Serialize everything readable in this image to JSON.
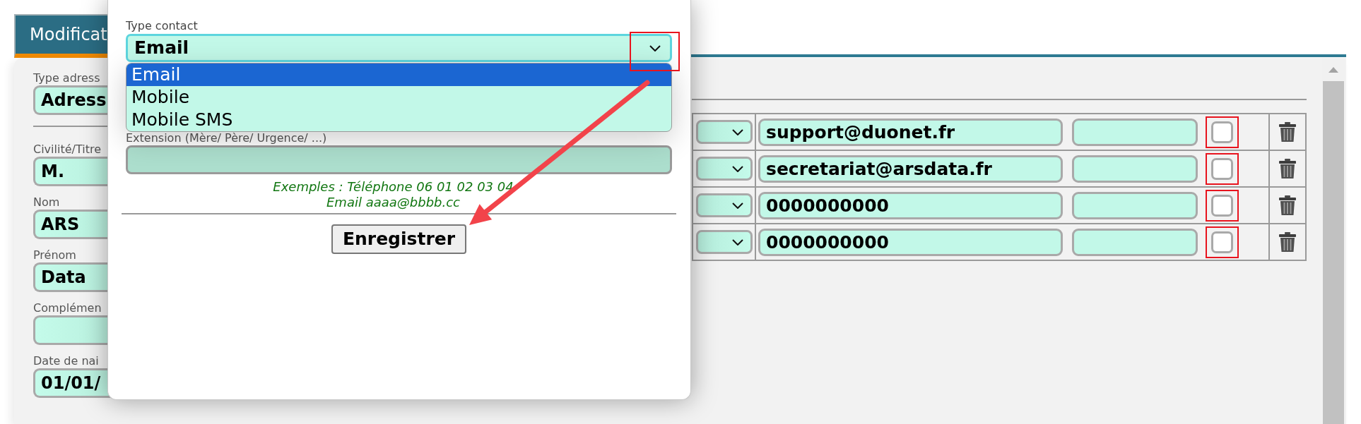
{
  "tab": {
    "label": "Modificat",
    "selected": true
  },
  "address_form": {
    "sections": [
      [
        {
          "label": "Type adress",
          "value": "Adress"
        }
      ],
      [
        {
          "label": "Civilité/Titre",
          "value": "M."
        },
        {
          "label": "Nom",
          "value": "ARS"
        },
        {
          "label": "Prénom",
          "value": "Data"
        },
        {
          "label": "Complémen"
        },
        {
          "label": "Date de nai",
          "value": "01/01/"
        }
      ]
    ]
  },
  "contacts": {
    "rows": [
      {
        "value": "support@duonet.fr",
        "checked": false,
        "highlighted": true
      },
      {
        "value": "secretariat@arsdata.fr",
        "checked": false,
        "highlighted": true
      },
      {
        "value": "0000000000",
        "checked": false,
        "highlighted": true
      },
      {
        "value": "0000000000",
        "checked": false,
        "highlighted": true
      }
    ]
  },
  "contact_modal": {
    "type_label": "Type contact",
    "type_value": "Email",
    "highlighted": true,
    "expanded": true,
    "options": [
      {
        "label": "Email",
        "selected": true
      },
      {
        "label": "Mobile",
        "selected": false
      },
      {
        "label": "Mobile SMS",
        "selected": false
      }
    ],
    "extension_label": "Extension (Mère/ Père/ Urgence/ ...)",
    "hints": [
      "Exemples : Téléphone 06 01 02 03 04",
      "Email aaaa@bbbb.cc"
    ],
    "save_button": "Enregistrer",
    "annotation_arrow": true
  }
}
